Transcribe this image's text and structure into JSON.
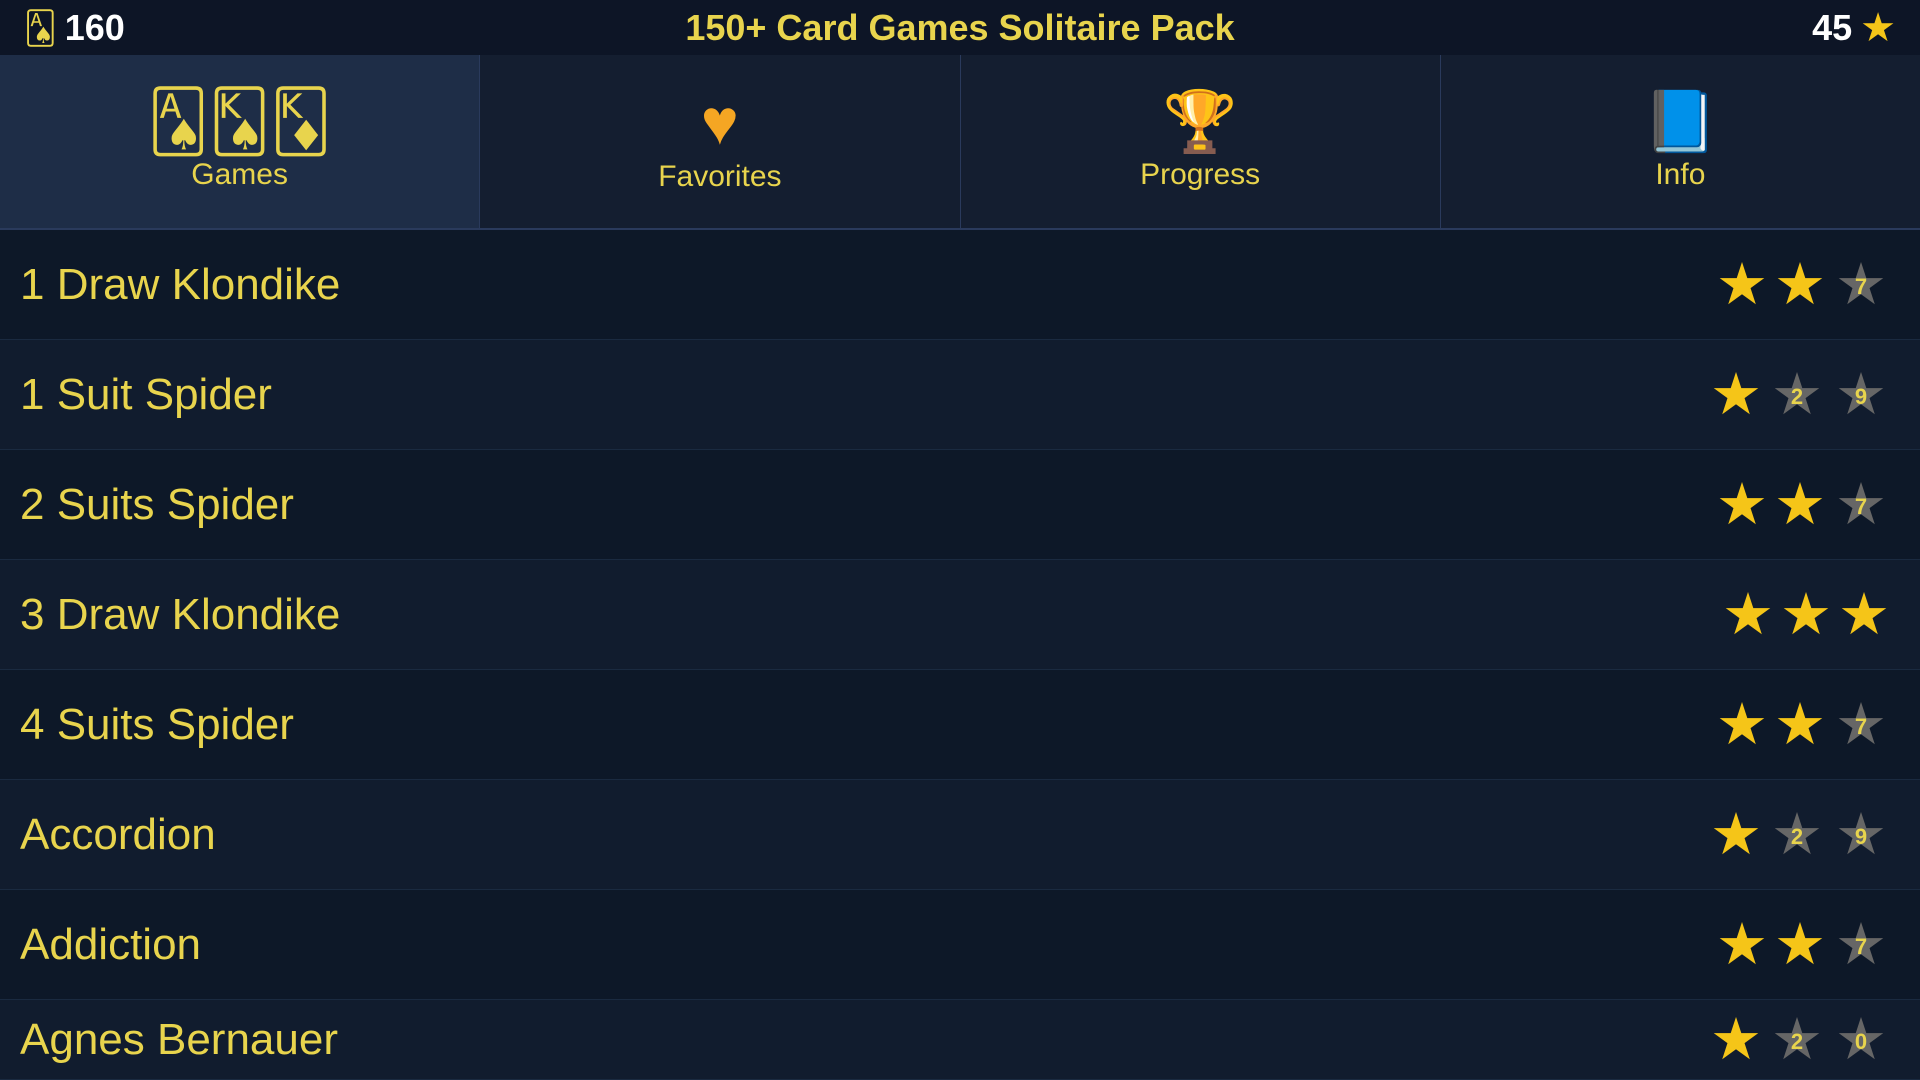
{
  "topbar": {
    "score": "160",
    "title": "150+ Card Games Solitaire Pack",
    "stars_count": "45"
  },
  "tabs": [
    {
      "id": "games",
      "label": "Games",
      "active": true
    },
    {
      "id": "favorites",
      "label": "Favorites",
      "active": false
    },
    {
      "id": "progress",
      "label": "Progress",
      "active": false
    },
    {
      "id": "info",
      "label": "Info",
      "active": false
    }
  ],
  "games": [
    {
      "name": "1 Draw Klondike",
      "stars": [
        "gold",
        "gold",
        "grey7"
      ]
    },
    {
      "name": "1 Suit Spider",
      "stars": [
        "gold",
        "grey2",
        "grey9"
      ]
    },
    {
      "name": "2 Suits Spider",
      "stars": [
        "gold",
        "gold",
        "grey7"
      ]
    },
    {
      "name": "3 Draw Klondike",
      "stars": [
        "gold",
        "gold",
        "gold"
      ]
    },
    {
      "name": "4 Suits Spider",
      "stars": [
        "gold",
        "gold_half",
        "grey7"
      ]
    },
    {
      "name": "Accordion",
      "stars": [
        "gold",
        "grey2",
        "grey9"
      ]
    },
    {
      "name": "Addiction",
      "stars": [
        "gold",
        "gold",
        "grey7"
      ]
    },
    {
      "name": "Agnes Bernauer",
      "stars": [
        "gold",
        "grey2",
        "grey0"
      ]
    }
  ]
}
